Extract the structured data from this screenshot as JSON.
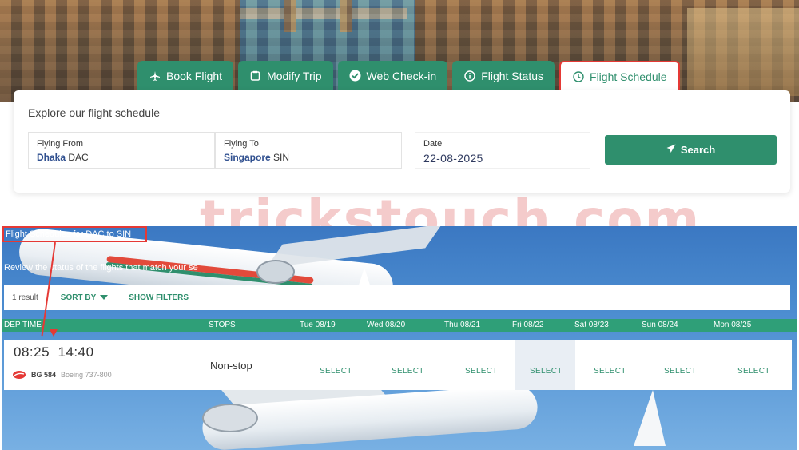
{
  "tabs": [
    {
      "label": "Book Flight",
      "icon": "plane-depart-icon",
      "active": false
    },
    {
      "label": "Modify Trip",
      "icon": "clipboard-icon",
      "active": false
    },
    {
      "label": "Web Check-in",
      "icon": "check-circle-icon",
      "active": false
    },
    {
      "label": "Flight Status",
      "icon": "info-circle-icon",
      "active": false
    },
    {
      "label": "Flight Schedule",
      "icon": "clock-icon",
      "active": true
    }
  ],
  "search": {
    "heading": "Explore our flight schedule",
    "from": {
      "label": "Flying From",
      "city": "Dhaka",
      "code": "DAC"
    },
    "to": {
      "label": "Flying To",
      "city": "Singapore",
      "code": "SIN"
    },
    "date": {
      "label": "Date",
      "value": "22-08-2025"
    },
    "button": "Search",
    "button_icon": "paper-plane-icon"
  },
  "watermark": "trickstouch.com",
  "schedule": {
    "title": "Flight Schedules for DAC to SIN",
    "subtitle": "Review the status of the flights that match your se",
    "result_count": "1 result",
    "sort_by": "SORT BY",
    "show_filters": "SHOW FILTERS",
    "columns": {
      "dep_time": "DEP TIME",
      "stops": "STOPS",
      "days": [
        "Tue 08/19",
        "Wed 08/20",
        "Thu 08/21",
        "Fri 08/22",
        "Sat 08/23",
        "Sun 08/24",
        "Mon 08/25"
      ]
    },
    "flight": {
      "dep": "08:25",
      "arr": "14:40",
      "flight_no": "BG 584",
      "aircraft": "Boeing 737-800",
      "stops": "Non-stop",
      "select_label": "SELECT",
      "selected_day_index": 3
    }
  },
  "colors": {
    "brand_green": "#2f8f6d",
    "annotation_red": "#e53935"
  }
}
